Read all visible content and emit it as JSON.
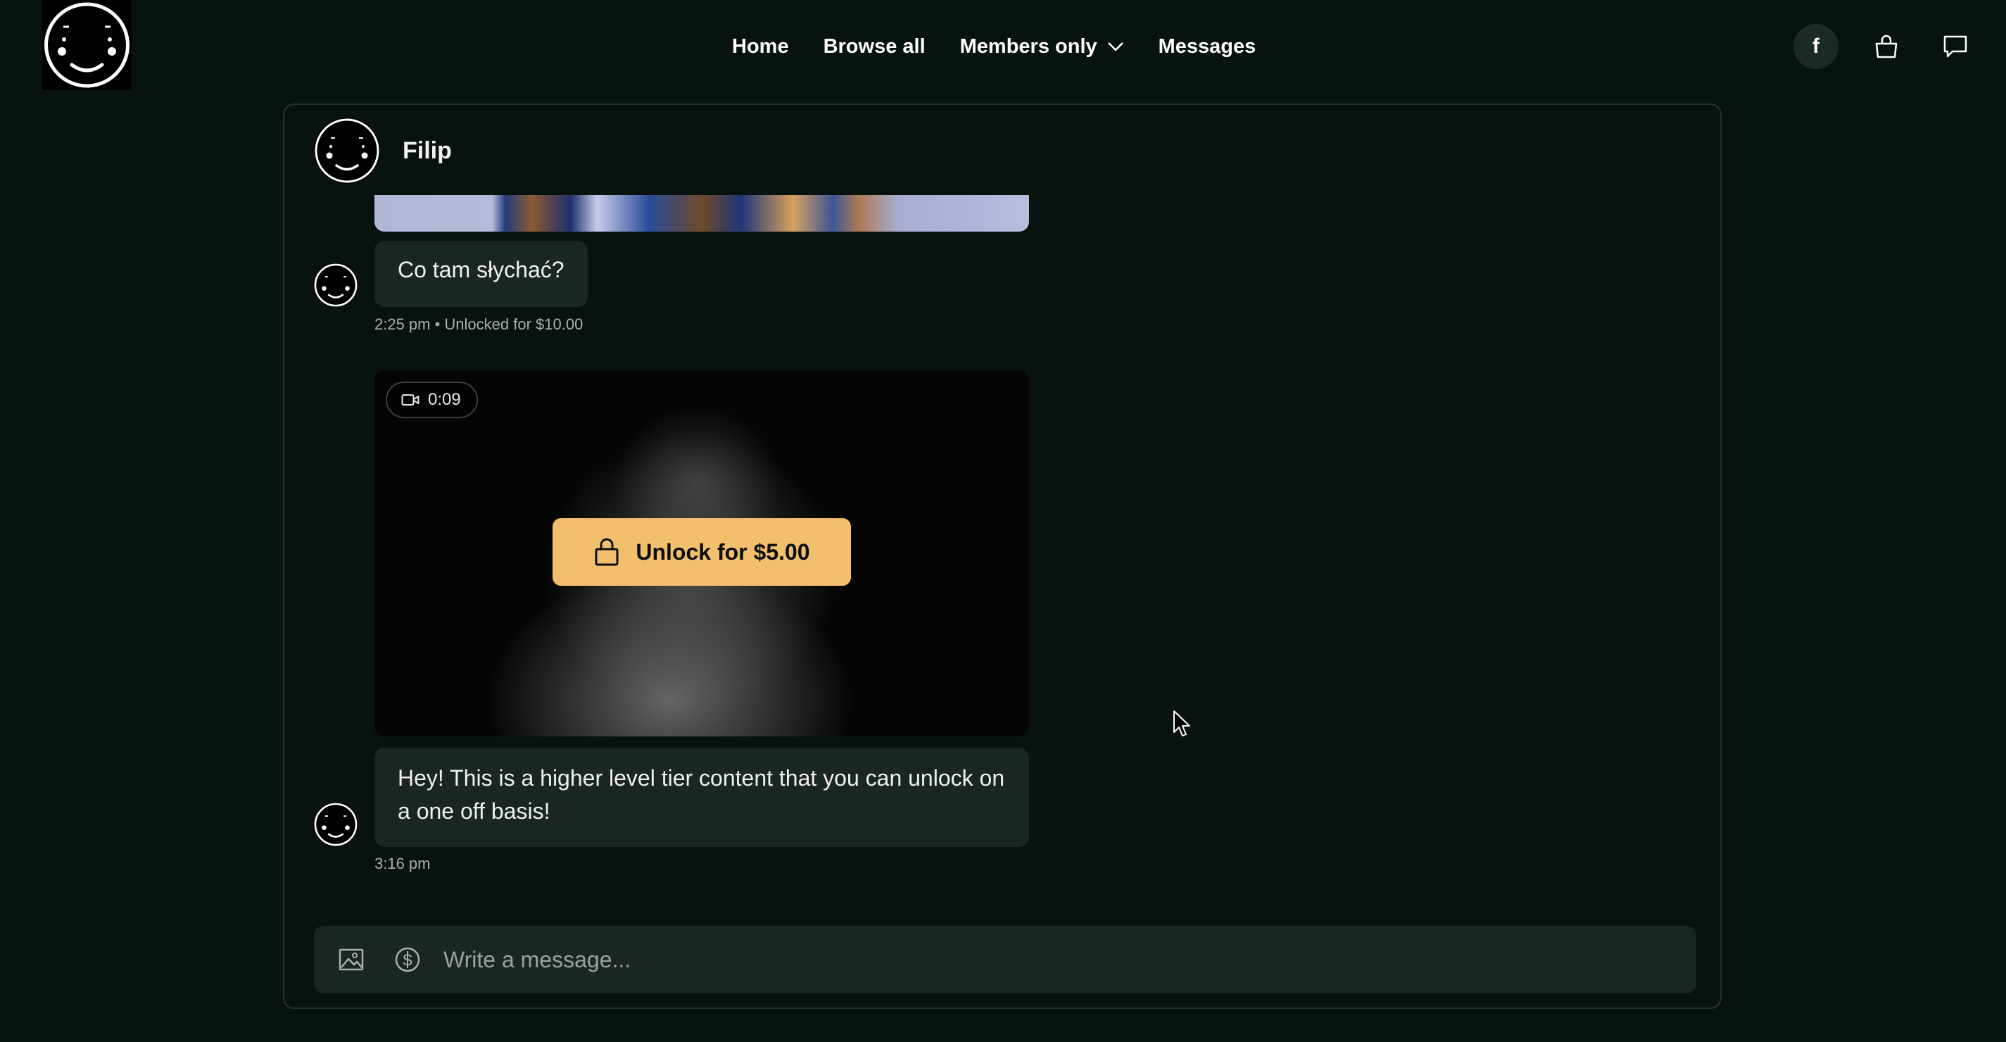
{
  "nav": {
    "items": [
      {
        "label": "Home"
      },
      {
        "label": "Browse all"
      },
      {
        "label": "Members only",
        "has_dropdown": true
      },
      {
        "label": "Messages"
      }
    ]
  },
  "header_icons": {
    "facebook_label": "f",
    "icons": [
      "facebook-icon",
      "shopping-bag-icon",
      "chat-icon"
    ]
  },
  "chat": {
    "contact_name": "Filip",
    "messages": [
      {
        "type": "image",
        "icon": "image-thumbnail"
      },
      {
        "type": "text",
        "text": "Co tam słychać?",
        "meta": "2:25 pm • Unlocked for $10.00"
      },
      {
        "type": "video",
        "duration": "0:09",
        "unlock_label": "Unlock for $5.00"
      },
      {
        "type": "text",
        "text": "Hey! This is a higher level tier content that you can unlock on a one off basis!",
        "meta": "3:16 pm"
      }
    ]
  },
  "composer": {
    "placeholder": "Write a message...",
    "icons": [
      "image-upload-icon",
      "dollar-icon"
    ]
  },
  "colors": {
    "background": "#07130f",
    "bubble": "#1a2623",
    "accent": "#f2c06c",
    "border": "#26332f"
  }
}
